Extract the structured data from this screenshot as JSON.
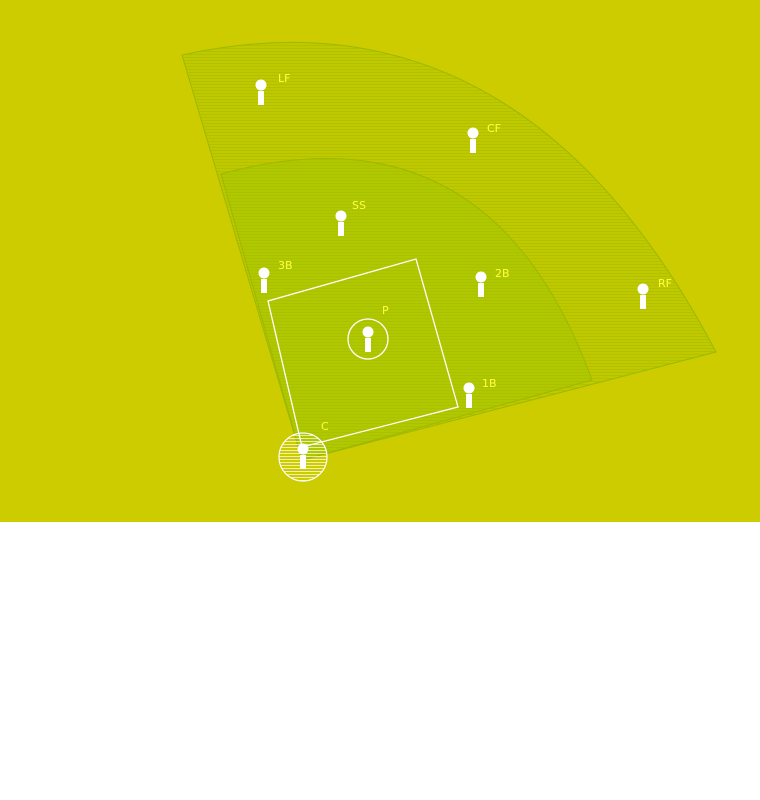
{
  "colors": {
    "background": "#cccc00",
    "outfield": "#c0c800",
    "infield": "#b0c800",
    "field_edge": "#9cb800",
    "hatch": "#a4bc00",
    "diamond_line": "#ffffff",
    "player": "#ffffff",
    "label": "#ffff44"
  },
  "positions": [
    {
      "id": "lf",
      "label": "LF"
    },
    {
      "id": "cf",
      "label": "CF"
    },
    {
      "id": "ss",
      "label": "SS"
    },
    {
      "id": "3b",
      "label": "3B"
    },
    {
      "id": "2b",
      "label": "2B"
    },
    {
      "id": "rf",
      "label": "RF"
    },
    {
      "id": "p",
      "label": "P"
    },
    {
      "id": "1b",
      "label": "1B"
    },
    {
      "id": "c",
      "label": "C"
    }
  ]
}
